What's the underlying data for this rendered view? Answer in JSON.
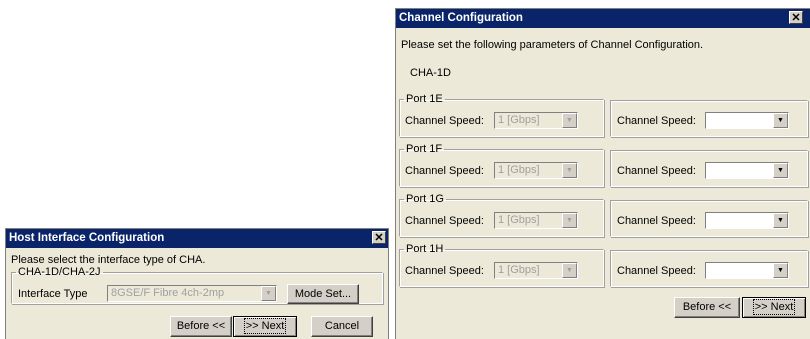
{
  "host_dialog": {
    "title": "Host Interface Configuration",
    "instruction": "Please select the interface type of CHA.",
    "group_label": "CHA-1D/CHA-2J",
    "interface_type_label": "Interface Type",
    "interface_type_value": "8GSE/F Fibre 4ch-2mp",
    "mode_set_label": "Mode Set...",
    "before_label": "Before <<",
    "next_label": ">> Next",
    "cancel_label": "Cancel"
  },
  "channel_dialog": {
    "title": "Channel Configuration",
    "instruction": "Please set the following parameters of Channel Configuration.",
    "cha_label": "CHA-1D",
    "speed_label": "Channel Speed:",
    "ports": [
      {
        "label": "Port 1E",
        "speed_value": "1 [Gbps]"
      },
      {
        "label": "Port 1F",
        "speed_value": "1 [Gbps]"
      },
      {
        "label": "Port 1G",
        "speed_value": "1 [Gbps]"
      },
      {
        "label": "Port 1H",
        "speed_value": "1 [Gbps]"
      }
    ],
    "before_label": "Before <<",
    "next_label": ">> Next"
  },
  "icons": {
    "close": "close-icon",
    "dropdown": "chevron-down-icon"
  }
}
